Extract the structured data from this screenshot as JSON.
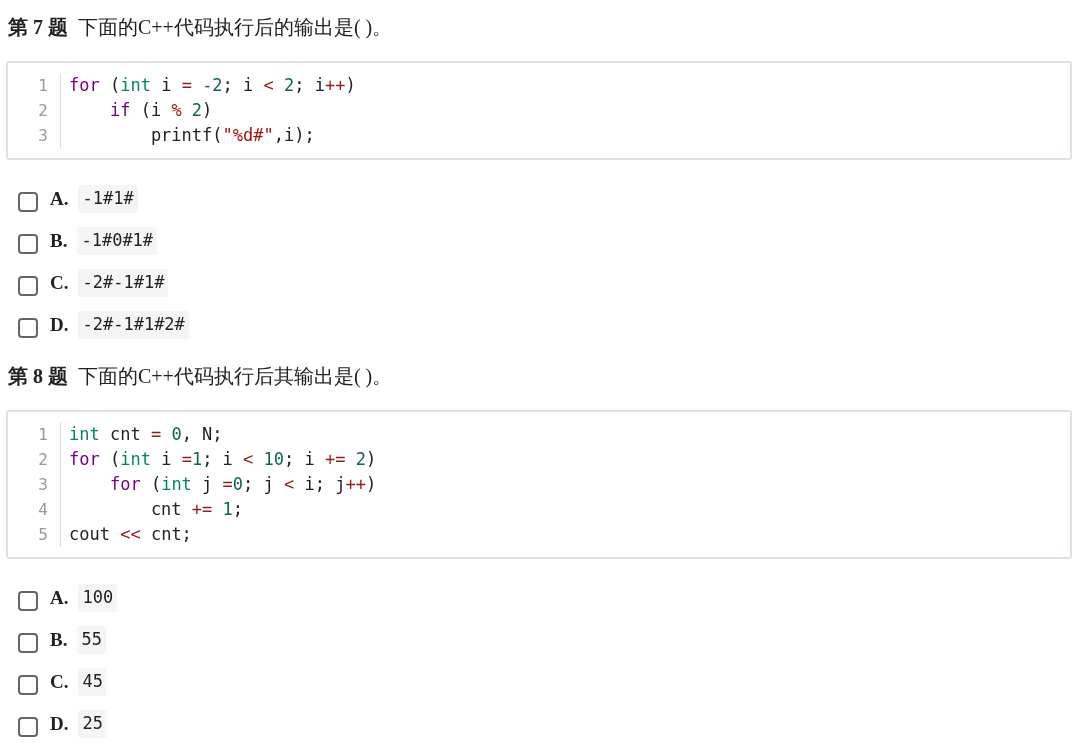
{
  "questions": [
    {
      "number_label": "第 7 题",
      "prompt": "下面的C++代码执行后的输出是(   )。",
      "code_lines": [
        {
          "number": "1",
          "tokens": [
            {
              "kind": "keyword",
              "text": "for"
            },
            {
              "kind": "plain",
              "text": " ("
            },
            {
              "kind": "type",
              "text": "int"
            },
            {
              "kind": "plain",
              "text": " i "
            },
            {
              "kind": "operator",
              "text": "="
            },
            {
              "kind": "number",
              "text": " -2"
            },
            {
              "kind": "plain",
              "text": "; i "
            },
            {
              "kind": "operator",
              "text": "<"
            },
            {
              "kind": "number",
              "text": " 2"
            },
            {
              "kind": "plain",
              "text": "; i"
            },
            {
              "kind": "operator",
              "text": "++"
            },
            {
              "kind": "plain",
              "text": ")"
            }
          ]
        },
        {
          "number": "2",
          "tokens": [
            {
              "kind": "keyword",
              "text": "    if"
            },
            {
              "kind": "plain",
              "text": " (i "
            },
            {
              "kind": "operator",
              "text": "%"
            },
            {
              "kind": "number",
              "text": " 2"
            },
            {
              "kind": "plain",
              "text": ")"
            }
          ]
        },
        {
          "number": "3",
          "tokens": [
            {
              "kind": "plain",
              "text": "        printf("
            },
            {
              "kind": "string",
              "text": "\"%d#\""
            },
            {
              "kind": "plain",
              "text": ",i);"
            }
          ]
        }
      ],
      "options": [
        {
          "letter": "A.",
          "text": "-1#1#",
          "checked": false
        },
        {
          "letter": "B.",
          "text": "-1#0#1#",
          "checked": false
        },
        {
          "letter": "C.",
          "text": "-2#-1#1#",
          "checked": false
        },
        {
          "letter": "D.",
          "text": "-2#-1#1#2#",
          "checked": false
        }
      ]
    },
    {
      "number_label": "第 8 题",
      "prompt": "下面的C++代码执行后其输出是(   )。",
      "code_lines": [
        {
          "number": "1",
          "tokens": [
            {
              "kind": "type",
              "text": "int"
            },
            {
              "kind": "plain",
              "text": " cnt "
            },
            {
              "kind": "operator",
              "text": "="
            },
            {
              "kind": "number",
              "text": " 0"
            },
            {
              "kind": "plain",
              "text": ", N;"
            }
          ]
        },
        {
          "number": "2",
          "tokens": [
            {
              "kind": "keyword",
              "text": "for"
            },
            {
              "kind": "plain",
              "text": " ("
            },
            {
              "kind": "type",
              "text": "int"
            },
            {
              "kind": "plain",
              "text": " i "
            },
            {
              "kind": "operator",
              "text": "="
            },
            {
              "kind": "number",
              "text": "1"
            },
            {
              "kind": "plain",
              "text": "; i "
            },
            {
              "kind": "operator",
              "text": "<"
            },
            {
              "kind": "number",
              "text": " 10"
            },
            {
              "kind": "plain",
              "text": "; i "
            },
            {
              "kind": "operator",
              "text": "+="
            },
            {
              "kind": "number",
              "text": " 2"
            },
            {
              "kind": "plain",
              "text": ")"
            }
          ]
        },
        {
          "number": "3",
          "tokens": [
            {
              "kind": "keyword",
              "text": "    for"
            },
            {
              "kind": "plain",
              "text": " ("
            },
            {
              "kind": "type",
              "text": "int"
            },
            {
              "kind": "plain",
              "text": " j "
            },
            {
              "kind": "operator",
              "text": "="
            },
            {
              "kind": "number",
              "text": "0"
            },
            {
              "kind": "plain",
              "text": "; j "
            },
            {
              "kind": "operator",
              "text": "<"
            },
            {
              "kind": "plain",
              "text": " i; j"
            },
            {
              "kind": "operator",
              "text": "++"
            },
            {
              "kind": "plain",
              "text": ")"
            }
          ]
        },
        {
          "number": "4",
          "tokens": [
            {
              "kind": "plain",
              "text": "        cnt "
            },
            {
              "kind": "operator",
              "text": "+="
            },
            {
              "kind": "number",
              "text": " 1"
            },
            {
              "kind": "plain",
              "text": ";"
            }
          ]
        },
        {
          "number": "5",
          "tokens": [
            {
              "kind": "plain",
              "text": "cout "
            },
            {
              "kind": "operator",
              "text": "<<"
            },
            {
              "kind": "plain",
              "text": " cnt;"
            }
          ]
        }
      ],
      "options": [
        {
          "letter": "A.",
          "text": "100",
          "checked": false
        },
        {
          "letter": "B.",
          "text": "55",
          "checked": false
        },
        {
          "letter": "C.",
          "text": "45",
          "checked": false
        },
        {
          "letter": "D.",
          "text": "25",
          "checked": false
        }
      ]
    }
  ]
}
